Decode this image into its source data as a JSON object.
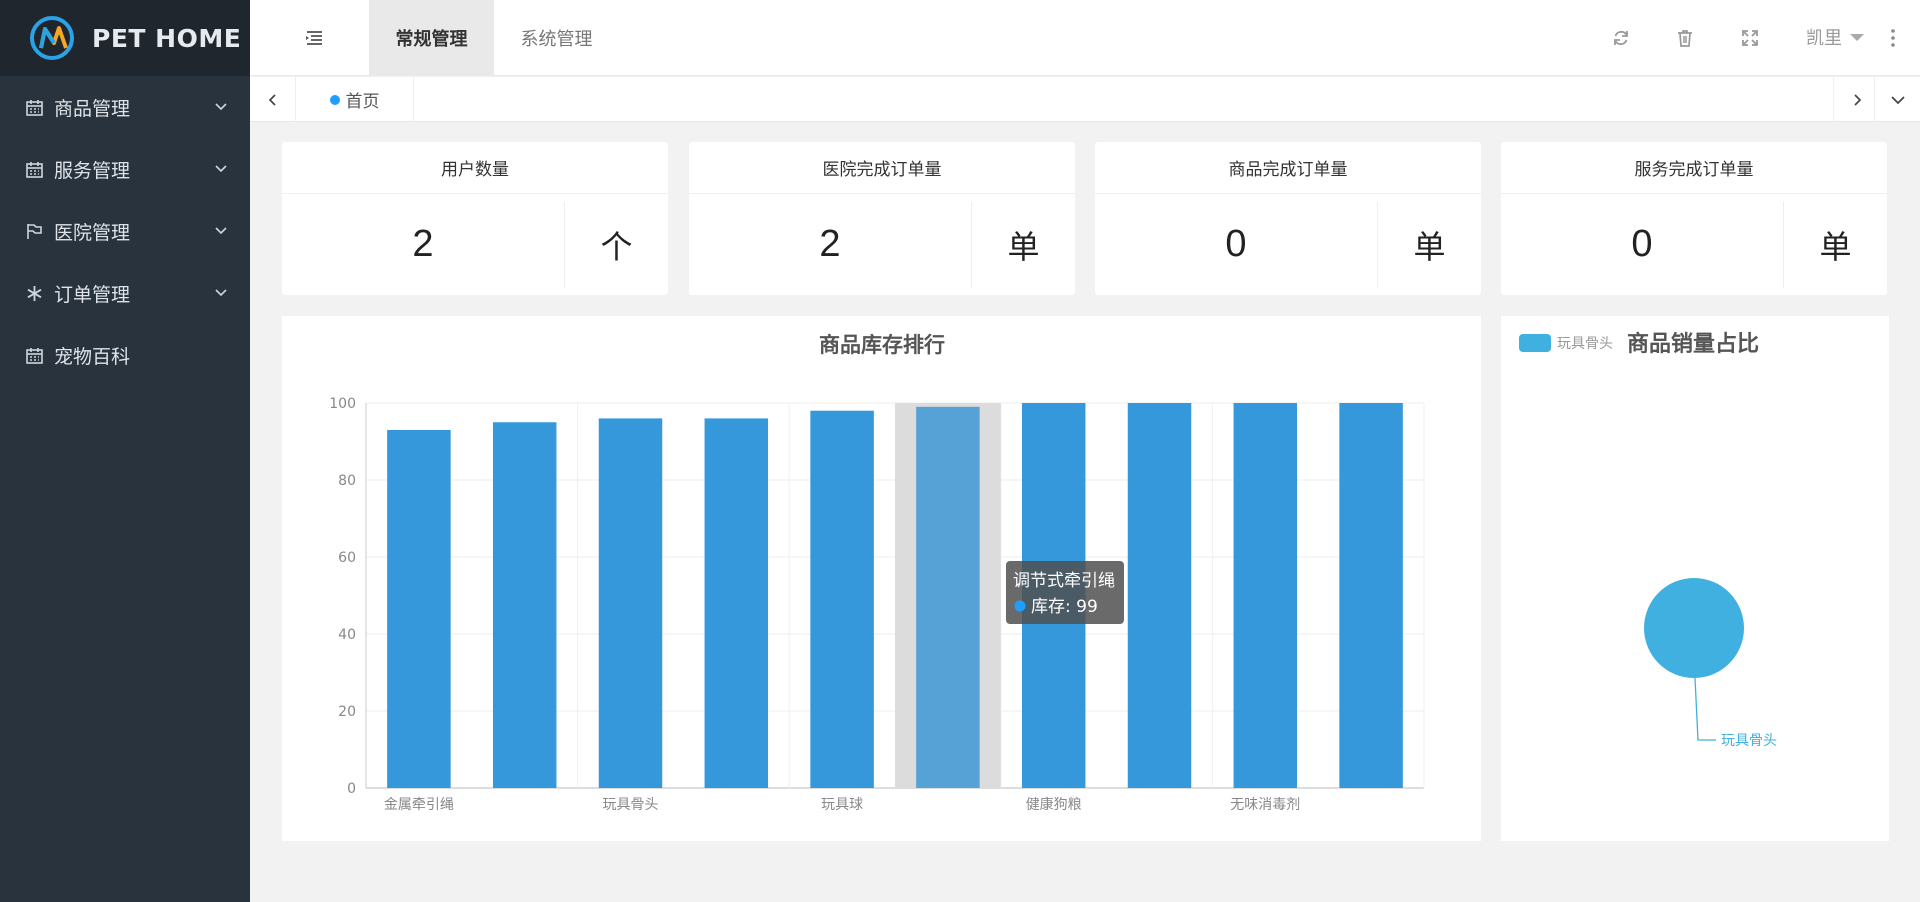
{
  "app": {
    "logo_text": "PET HOME"
  },
  "sidebar": {
    "items": [
      {
        "label": "商品管理",
        "icon": "calendar-icon",
        "expandable": true
      },
      {
        "label": "服务管理",
        "icon": "calendar-icon",
        "expandable": true
      },
      {
        "label": "医院管理",
        "icon": "flag-icon",
        "expandable": true
      },
      {
        "label": "订单管理",
        "icon": "snowflake-icon",
        "expandable": true
      },
      {
        "label": "宠物百科",
        "icon": "calendar-icon",
        "expandable": false
      }
    ]
  },
  "header": {
    "tabs": [
      {
        "label": "常规管理",
        "active": true
      },
      {
        "label": "系统管理",
        "active": false
      }
    ],
    "icons": [
      "refresh-icon",
      "trash-icon",
      "fullscreen-icon"
    ],
    "user": "凯里"
  },
  "tabbar": {
    "home_label": "首页"
  },
  "stats": [
    {
      "title": "用户数量",
      "value": "2",
      "unit": "个"
    },
    {
      "title": "医院完成订单量",
      "value": "2",
      "unit": "单"
    },
    {
      "title": "商品完成订单量",
      "value": "0",
      "unit": "单"
    },
    {
      "title": "服务完成订单量",
      "value": "0",
      "unit": "单"
    }
  ],
  "colors": {
    "bar": "#3498db",
    "bar_highlight": "#56a1d5",
    "pie": "#40b0e0",
    "sidebar": "#28333e",
    "accent": "#1e9fff"
  },
  "chart_data": [
    {
      "type": "bar",
      "title": "商品库存排行",
      "series_label": "库存",
      "values": [
        93,
        95,
        96,
        96,
        98,
        99,
        100,
        100,
        100,
        100
      ],
      "x_tick_labels": [
        "金属牵引绳",
        "玩具骨头",
        "玩具球",
        "健康狗粮",
        "无味消毒剂"
      ],
      "ylim": [
        0,
        100
      ],
      "yticks": [
        0,
        20,
        40,
        60,
        80,
        100
      ],
      "grid": true,
      "tooltip": {
        "title": "调节式牵引绳",
        "label": "库存",
        "value": "99",
        "bar_index": 5
      }
    },
    {
      "type": "pie",
      "title": "商品销量占比",
      "legend": [
        "玩具骨头"
      ],
      "legend_position": "top-left",
      "slices": [
        {
          "name": "玩具骨头",
          "value": 1
        }
      ]
    }
  ]
}
